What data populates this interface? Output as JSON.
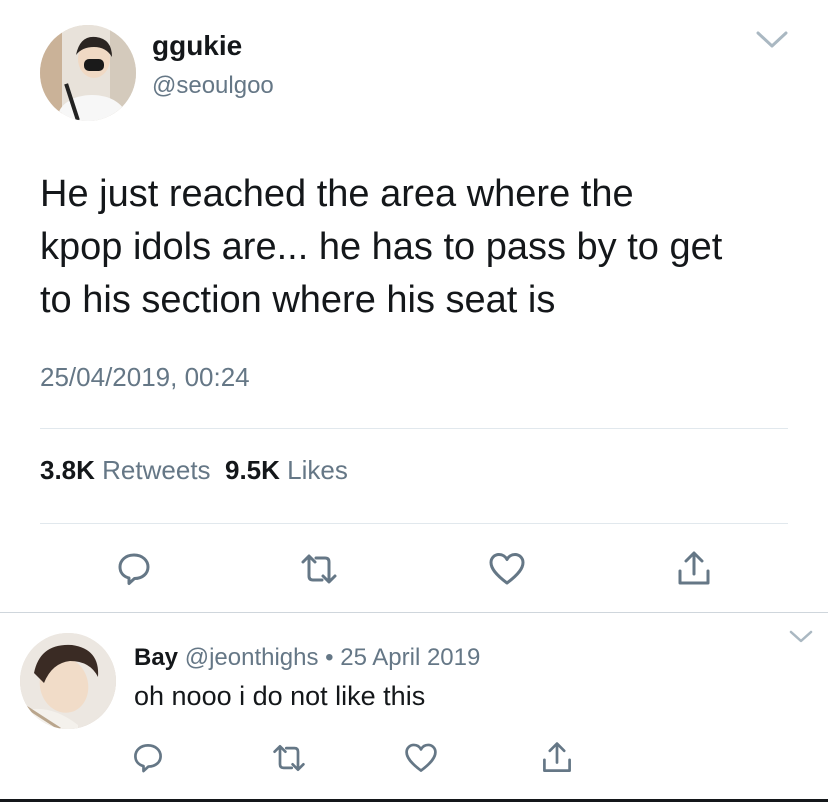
{
  "main_tweet": {
    "author": {
      "display_name": "ggukie",
      "handle": "@seoulgoo"
    },
    "text_lines": [
      "He just reached the area where the",
      "kpop idols are... he has to pass by to get",
      "to his section where his seat is"
    ],
    "timestamp": "25/04/2019, 00:24",
    "stats": {
      "retweets_count": "3.8K",
      "retweets_label": "Retweets",
      "likes_count": "9.5K",
      "likes_label": "Likes"
    },
    "icons": [
      "reply-icon",
      "retweet-icon",
      "like-icon",
      "share-icon",
      "chevron-down-icon"
    ]
  },
  "reply_tweet": {
    "author": {
      "display_name": "Bay",
      "handle": "@jeonthighs"
    },
    "separator": "•",
    "date": "25 April 2019",
    "text": "oh nooo i do not like this",
    "icons": [
      "reply-icon",
      "retweet-icon",
      "like-icon",
      "share-icon",
      "chevron-down-icon"
    ]
  },
  "colors": {
    "text_primary": "#14171a",
    "text_secondary": "#657786",
    "divider": "#e1e8ed"
  }
}
